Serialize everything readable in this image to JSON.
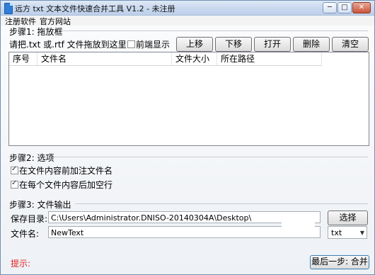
{
  "window": {
    "title": "远方 txt 文本文件快速合并工具 V1.2 - 未注册",
    "controls": {
      "minimize": "─",
      "maximize": "□",
      "close": "✕"
    }
  },
  "menu": {
    "items": [
      "注册软件",
      "官方网站"
    ]
  },
  "step1": {
    "label": "步骤1: 拖放框",
    "hint": "请把.txt 或.rtf 文件拖放到这里!",
    "front_label": "前端显示",
    "front_checked": false,
    "buttons": {
      "up": "上移",
      "down": "下移",
      "open": "打开",
      "delete": "删除",
      "clear": "清空"
    },
    "columns": [
      "序号",
      "文件名",
      "文件大小",
      "所在路径"
    ],
    "rows": []
  },
  "step2": {
    "label": "步骤2: 选项",
    "option1": "在文件内容前加注文件名",
    "option1_checked": true,
    "option2": "在每个文件内容后加空行",
    "option2_checked": true
  },
  "step3": {
    "label": "步骤3: 文件输出",
    "save_dir_label": "保存目录:",
    "save_dir_value": "C:\\Users\\Administrator.DNISO-20140304A\\Desktop\\",
    "browse_button": "选择",
    "filename_label": "文件名:",
    "filename_value": "NewText",
    "ext_value": "txt"
  },
  "footer": {
    "tip_label": "提示:",
    "merge_button": "最后一步: 合并"
  }
}
